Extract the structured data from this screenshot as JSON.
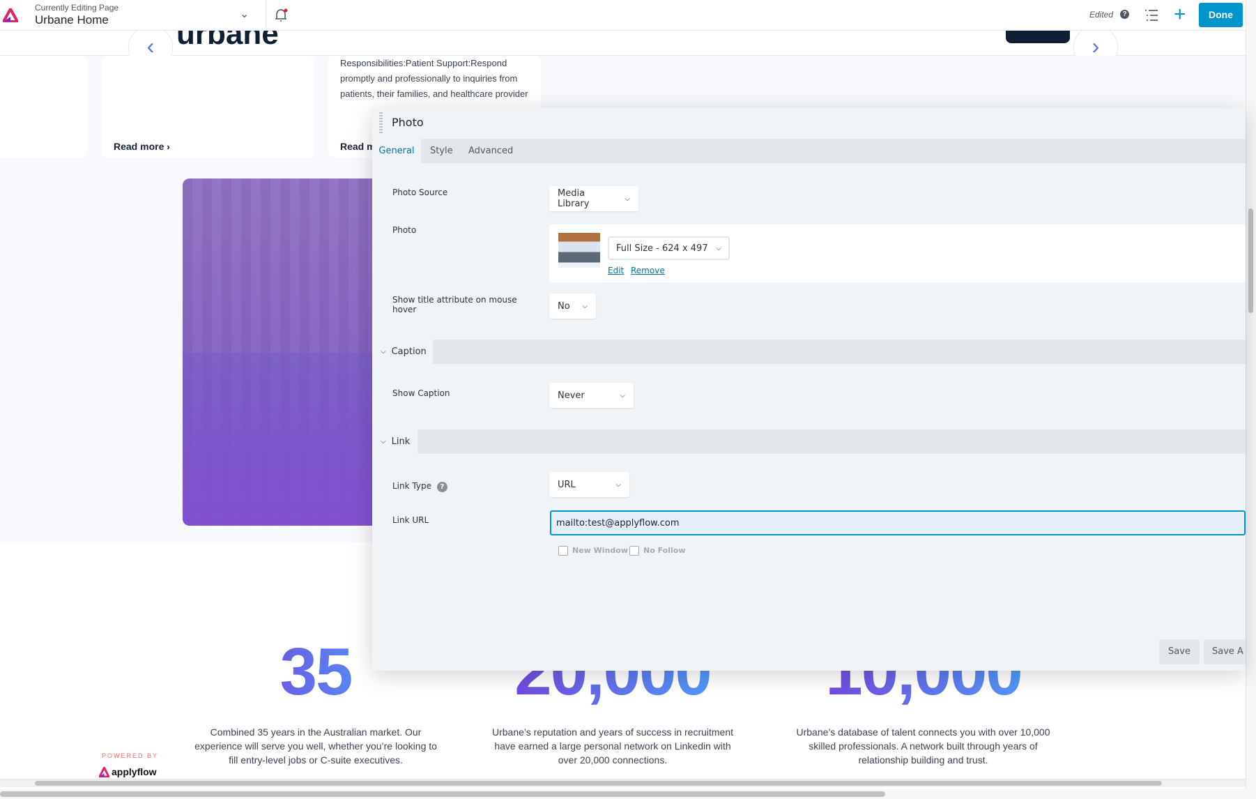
{
  "header": {
    "subtitle": "Currently Editing Page",
    "title": "Urbane Home",
    "status": "Edited",
    "done_label": "Done"
  },
  "page": {
    "logo_text": "urbane",
    "card_text": "Responsibilities:Patient Support:Respond promptly and professionally to inquiries from patients, their families, and healthcare provider",
    "read_more": "Read more",
    "read_more_partial": "Read m",
    "stats": [
      {
        "value": "35",
        "desc": "Combined 35 years in the Australian market. Our experience will serve you well, whether you’re looking to fill entry-level jobs or C-suite executives."
      },
      {
        "value": "20,000",
        "desc": "Urbane’s reputation and years of success in recruitment have earned a large personal network on Linkedin with over 20,000 connections."
      },
      {
        "value": "10,000",
        "desc": "Urbane’s database of talent connects you with over 10,000 skilled professionals. A network built through years of relationship building and trust."
      }
    ],
    "powered_by": "POWERED BY",
    "powered_brand": "applyflow"
  },
  "panel": {
    "title": "Photo",
    "tabs": [
      "General",
      "Style",
      "Advanced"
    ],
    "photo_source": {
      "label": "Photo Source",
      "value": "Media Library"
    },
    "photo": {
      "label": "Photo",
      "size": "Full Size - 624 x 497",
      "edit": "Edit",
      "remove": "Remove"
    },
    "show_title": {
      "label": "Show title attribute on mouse hover",
      "value": "No"
    },
    "caption": {
      "section": "Caption",
      "label": "Show Caption",
      "value": "Never"
    },
    "link": {
      "section": "Link",
      "type_label": "Link Type",
      "type_value": "URL",
      "url_label": "Link URL",
      "url_value": "mailto:test@applyflow.com",
      "new_window": "New Window",
      "no_follow": "No Follow"
    },
    "save": "Save",
    "save_as": "Save A"
  },
  "colors": {
    "accent": "#0096cc",
    "stat_gradient_start": "#7a3bd8",
    "stat_gradient_end": "#4aa7ff"
  }
}
